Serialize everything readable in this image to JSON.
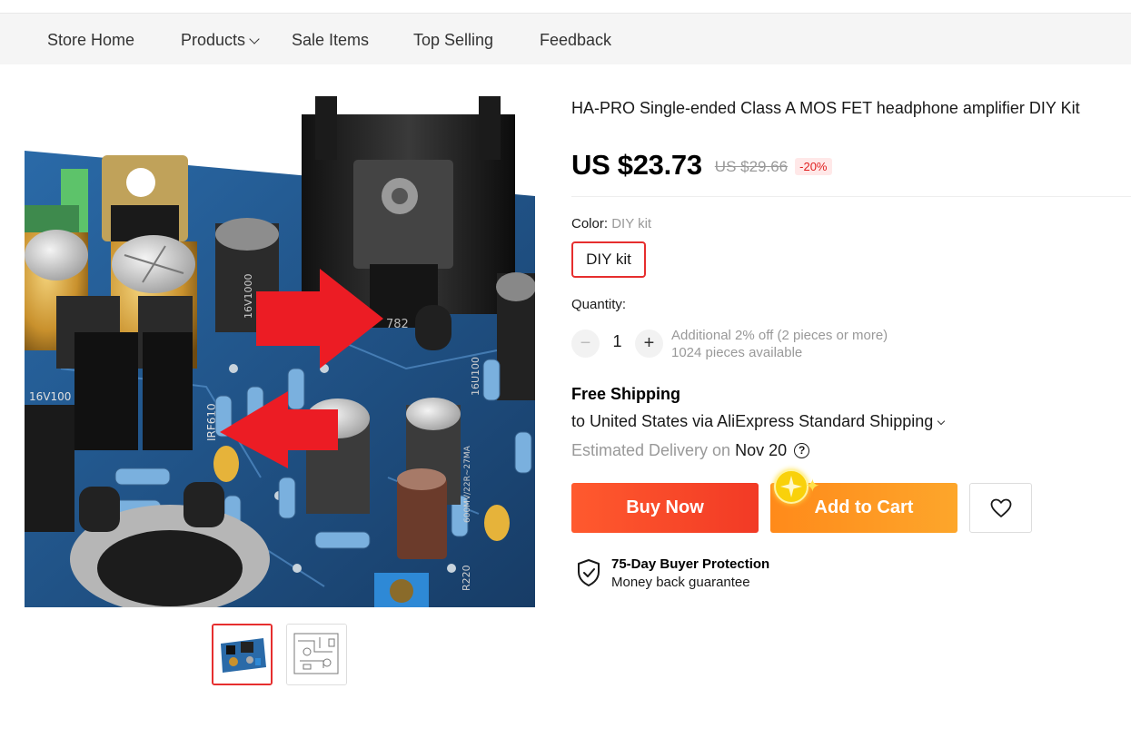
{
  "nav": {
    "items": [
      {
        "label": "Store Home"
      },
      {
        "label": "Products"
      },
      {
        "label": "Sale Items"
      },
      {
        "label": "Top Selling"
      },
      {
        "label": "Feedback"
      }
    ]
  },
  "product": {
    "title": "HA-PRO Single-ended Class A MOS FET headphone amplifier DIY Kit",
    "price_now": "US $23.73",
    "price_was": "US $29.66",
    "discount": "-20%",
    "color_label": "Color: ",
    "color_value": "DIY kit",
    "sku_option": "DIY kit",
    "board_text": {
      "cap1": "16V100",
      "cap2": "16V1000",
      "reg": "782",
      "mosfet": "IRF610",
      "label1": "R220",
      "label2": "16U100",
      "label3": "600MV/22R~27MA"
    }
  },
  "quantity": {
    "label": "Quantity:",
    "value": "1",
    "minus": "−",
    "plus": "+",
    "discount_note": "Additional 2% off (2 pieces or more)",
    "available": "1024 pieces available"
  },
  "shipping": {
    "title": "Free Shipping",
    "line": "to United States via AliExpress Standard Shipping",
    "delivery_label": "Estimated Delivery on",
    "delivery_date": "Nov 20",
    "help": "?"
  },
  "actions": {
    "buy_now": "Buy Now",
    "add_to_cart": "Add to Cart"
  },
  "protection": {
    "title": "75-Day Buyer Protection",
    "subtitle": "Money back guarantee"
  },
  "colors": {
    "accent_red": "#e62e2e",
    "buy_gradient": "#f23a25",
    "cart_gradient": "#fda62b",
    "muted": "#999999"
  },
  "icons": [
    "chevron-down-icon",
    "question-icon",
    "heart-icon",
    "shield-check-icon",
    "sparkle-icon"
  ]
}
